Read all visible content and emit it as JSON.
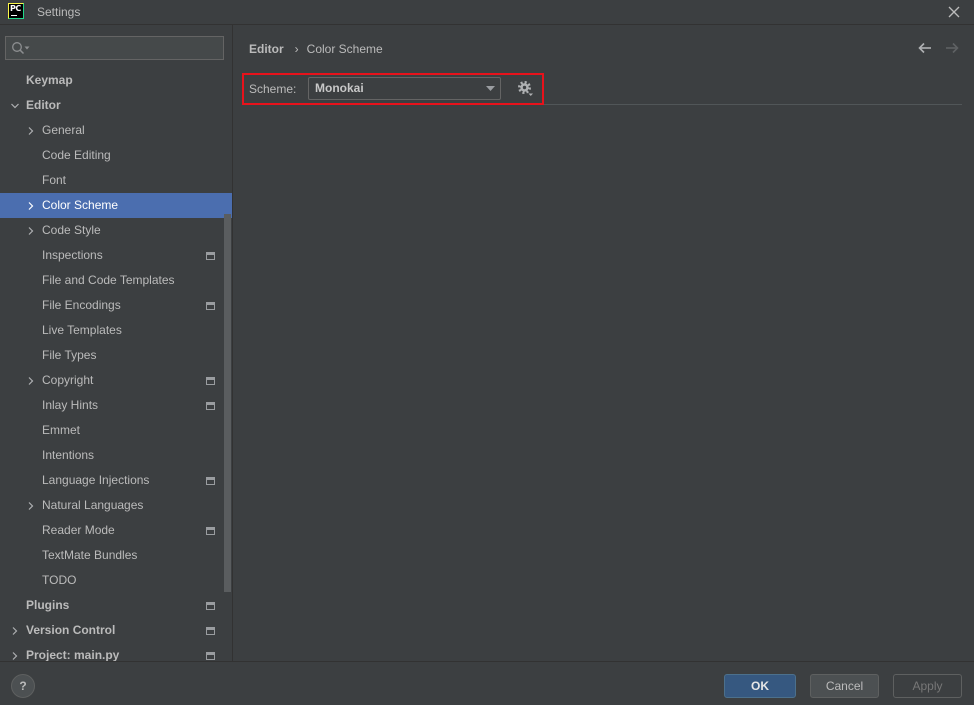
{
  "window": {
    "title": "Settings",
    "app_icon": "pycharm-icon",
    "app_icon_text": "PC",
    "close_icon": "close-icon"
  },
  "search": {
    "icon": "search-icon",
    "value": ""
  },
  "sidebar": {
    "items": [
      {
        "label": "Keymap"
      },
      {
        "label": "Editor",
        "expanded": true,
        "children": [
          {
            "label": "General",
            "expandable": true
          },
          {
            "label": "Code Editing"
          },
          {
            "label": "Font"
          },
          {
            "label": "Color Scheme",
            "expandable": true,
            "selected": true
          },
          {
            "label": "Code Style",
            "expandable": true
          },
          {
            "label": "Inspections",
            "project_level": true
          },
          {
            "label": "File and Code Templates"
          },
          {
            "label": "File Encodings",
            "project_level": true
          },
          {
            "label": "Live Templates"
          },
          {
            "label": "File Types"
          },
          {
            "label": "Copyright",
            "expandable": true,
            "project_level": true
          },
          {
            "label": "Inlay Hints",
            "project_level": true
          },
          {
            "label": "Emmet"
          },
          {
            "label": "Intentions"
          },
          {
            "label": "Language Injections",
            "project_level": true
          },
          {
            "label": "Natural Languages",
            "expandable": true
          },
          {
            "label": "Reader Mode",
            "project_level": true
          },
          {
            "label": "TextMate Bundles"
          },
          {
            "label": "TODO"
          }
        ]
      },
      {
        "label": "Plugins",
        "project_level": true
      },
      {
        "label": "Version Control",
        "expandable": true,
        "project_level": true
      },
      {
        "label": "Project: main.py",
        "expandable": true,
        "project_level": true
      }
    ]
  },
  "breadcrumb": {
    "parent": "Editor",
    "separator": "›",
    "current": "Color Scheme"
  },
  "navigation": {
    "back_icon": "arrow-left-icon",
    "forward_icon": "arrow-right-icon",
    "back_enabled": true,
    "forward_enabled": false
  },
  "scheme": {
    "label": "Scheme:",
    "selected": "Monokai",
    "dropdown_icon": "dropdown-arrow-icon",
    "settings_icon": "gear-icon"
  },
  "footer": {
    "help_label": "?",
    "ok_label": "OK",
    "cancel_label": "Cancel",
    "apply_label": "Apply",
    "apply_enabled": false
  },
  "icons": {
    "expand": "chevron-right-icon",
    "collapse": "chevron-down-icon",
    "project_level": "project-scope-icon"
  },
  "colors": {
    "background": "#3c3f41",
    "text": "#bbbbbb",
    "selection": "#4b6eaf",
    "primary_button": "#365880",
    "annotation_highlight": "#e8121b"
  }
}
